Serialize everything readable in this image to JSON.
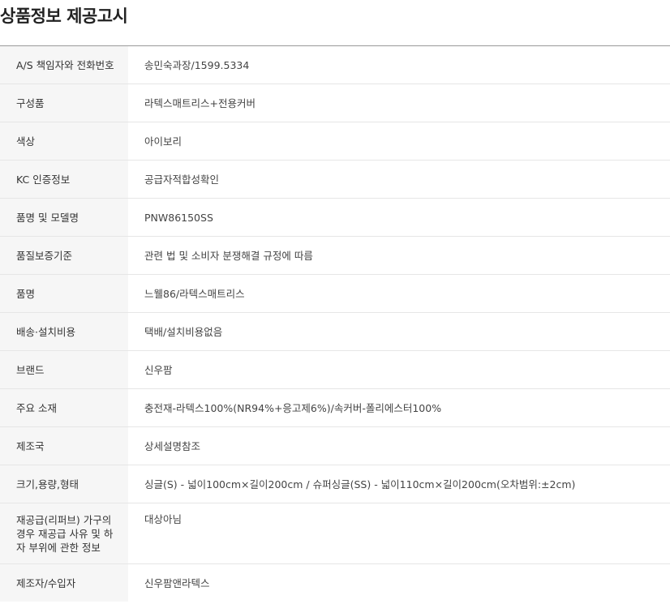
{
  "page": {
    "title": "상품정보 제공고시"
  },
  "rows": [
    {
      "label": "A/S 책임자와 전화번호",
      "value": "송민숙과장/1599.5334"
    },
    {
      "label": "구성품",
      "value": "라텍스매트리스+전용커버"
    },
    {
      "label": "색상",
      "value": "아이보리"
    },
    {
      "label": "KC 인증정보",
      "value": "공급자적합성확인"
    },
    {
      "label": "품명 및 모델명",
      "value": "PNW86150SS"
    },
    {
      "label": "품질보증기준",
      "value": "관련 법 및 소비자 분쟁해결 규정에 따름"
    },
    {
      "label": "품명",
      "value": "느웰86/라텍스매트리스"
    },
    {
      "label": "배송·설치비용",
      "value": "택배/설치비용없음"
    },
    {
      "label": "브랜드",
      "value": "신우팜"
    },
    {
      "label": "주요 소재",
      "value": "충전재-라텍스100%(NR94%+응고제6%)/속커버-폴리에스터100%"
    },
    {
      "label": "제조국",
      "value": "상세설명참조"
    },
    {
      "label": "크기,용량,형태",
      "value": "싱글(S) - 넓이100cm×길이200cm / 슈퍼싱글(SS) - 넓이110cm×길이200cm(오차범위:±2cm)"
    },
    {
      "label": "재공급(리퍼브) 가구의 경우 재공급 사유 및 하자 부위에 관한 정보",
      "value": "대상아님"
    },
    {
      "label": "제조자/수입자",
      "value": "신우팜앤라텍스"
    }
  ]
}
